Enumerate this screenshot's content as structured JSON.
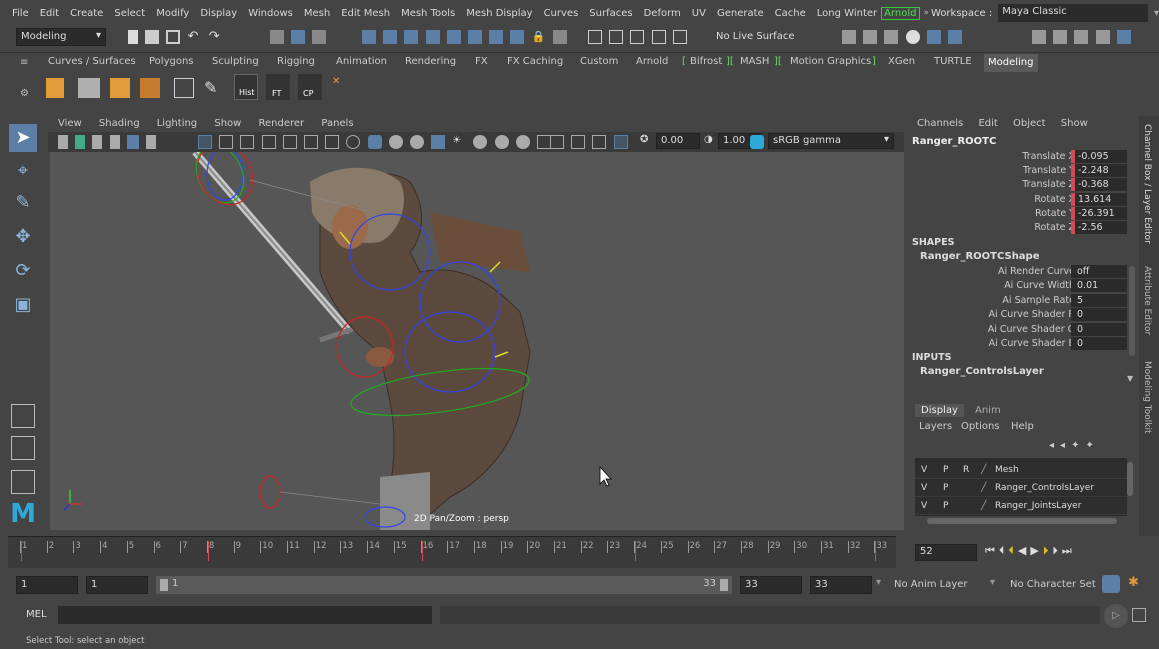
{
  "menubar": {
    "items": [
      "File",
      "Edit",
      "Create",
      "Select",
      "Modify",
      "Display",
      "Windows",
      "Mesh",
      "Edit Mesh",
      "Mesh Tools",
      "Mesh Display",
      "Curves",
      "Surfaces",
      "Deform",
      "UV",
      "Generate",
      "Cache",
      "Long Winter"
    ],
    "arnold": "Arnold",
    "workspace_label": "Workspace :",
    "workspace_value": "Maya Classic"
  },
  "statusline": {
    "menuset": "Modeling",
    "live_surface": "No Live Surface"
  },
  "shelf_tabs": [
    "Curves / Surfaces",
    "Polygons",
    "Sculpting",
    "Rigging",
    "Animation",
    "Rendering",
    "FX",
    "FX Caching",
    "Custom",
    "Arnold",
    "Bifrost",
    "MASH",
    "Motion Graphics",
    "XGen",
    "TURTLE",
    "Modeling"
  ],
  "shelf_active": "Modeling",
  "shelf_icon_labels": [
    "Hist",
    "FT",
    "CP"
  ],
  "viewport": {
    "menu": [
      "View",
      "Shading",
      "Lighting",
      "Show",
      "Renderer",
      "Panels"
    ],
    "exposure": "0.00",
    "gamma": "1.00",
    "colorspace": "sRGB gamma",
    "hud": "2D Pan/Zoom : persp"
  },
  "channel_box": {
    "menu": [
      "Channels",
      "Edit",
      "Object",
      "Show"
    ],
    "object": "Ranger_ROOTC",
    "channels": [
      {
        "name": "Translate X",
        "value": "-0.095"
      },
      {
        "name": "Translate Y",
        "value": "-2.248"
      },
      {
        "name": "Translate Z",
        "value": "-0.368"
      },
      {
        "name": "Rotate X",
        "value": "13.614"
      },
      {
        "name": "Rotate Y",
        "value": "-26.391"
      },
      {
        "name": "Rotate Z",
        "value": "-2.56"
      }
    ],
    "shapes_header": "SHAPES",
    "shape_name": "Ranger_ROOTCShape",
    "shape_attrs": [
      {
        "name": "Ai Render Curve",
        "value": "off"
      },
      {
        "name": "Ai Curve Width",
        "value": "0.01"
      },
      {
        "name": "Ai Sample Rate",
        "value": "5"
      },
      {
        "name": "Ai Curve Shader R",
        "value": "0"
      },
      {
        "name": "Ai Curve Shader G",
        "value": "0"
      },
      {
        "name": "Ai Curve Shader B",
        "value": "0"
      }
    ],
    "inputs_header": "INPUTS",
    "input_name": "Ranger_ControlsLayer"
  },
  "side_tabs": [
    "Channel Box / Layer Editor",
    "Attribute Editor",
    "Modeling Toolkit"
  ],
  "layer_editor": {
    "tabs": [
      "Display",
      "Anim"
    ],
    "menu": [
      "Layers",
      "Options",
      "Help"
    ],
    "layers": [
      {
        "v": "V",
        "p": "P",
        "r": "R",
        "name": "Mesh"
      },
      {
        "v": "V",
        "p": "P",
        "r": "",
        "name": "Ranger_ControlsLayer"
      },
      {
        "v": "V",
        "p": "P",
        "r": "",
        "name": "Ranger_JointsLayer"
      }
    ]
  },
  "timeline": {
    "ticks": [
      "1",
      "2",
      "3",
      "4",
      "5",
      "6",
      "7",
      "8",
      "9",
      "10",
      "11",
      "12",
      "13",
      "14",
      "15",
      "16",
      "17",
      "18",
      "19",
      "20",
      "21",
      "22",
      "23",
      "24",
      "25",
      "26",
      "27",
      "28",
      "29",
      "30",
      "31",
      "32",
      "33"
    ],
    "current_frame": "52"
  },
  "range": {
    "start": "1",
    "playback_start": "1",
    "slider_start": "1",
    "slider_end": "33",
    "playback_end": "33",
    "end": "33",
    "anim_layer": "No Anim Layer",
    "character_set": "No Character Set"
  },
  "cmdline": {
    "label": "MEL"
  },
  "helpline": {
    "text": "Select Tool: select an object"
  }
}
